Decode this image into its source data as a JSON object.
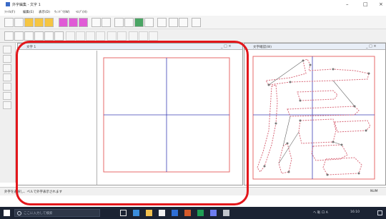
{
  "window": {
    "title": "外字編集 - 文字 1",
    "controls": [
      "–",
      "□",
      "×"
    ]
  },
  "menu": {
    "items": [
      "ﾌｧｲﾙ(F)",
      "編集(E)",
      "表示(D)",
      "ｳｨﾝﾄﾞｳ(W)",
      "ﾍﾙﾌﾟ(H)"
    ]
  },
  "edit_pane": {
    "title": "文字 1",
    "controls": "_ □ ×"
  },
  "preview_pane": {
    "title": "文字確認(W)",
    "controls": "_ □ ×"
  },
  "status": {
    "text": "外字を選択し、ペルで外字表示されます",
    "right": "NUM"
  },
  "taskbar": {
    "search_placeholder": "ここに入力して検索",
    "tray_text": "へ 恥 ロ A",
    "clock": "16:10"
  },
  "colors": {
    "highlight": "#e3161b",
    "guide_red": "#e76a6a",
    "guide_blue": "#3b3fb5",
    "outline_pink": "#d96a7a"
  }
}
